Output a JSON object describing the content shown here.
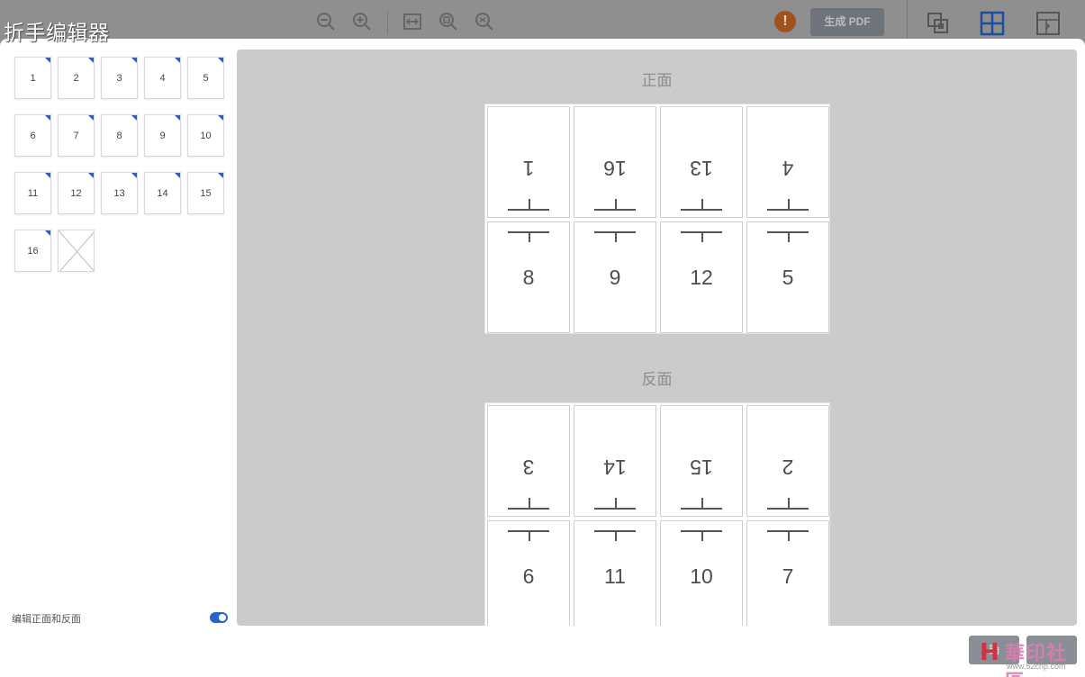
{
  "window": {
    "title": "折手编辑器"
  },
  "toolbar": {
    "generate_pdf_label": "生成 PDF",
    "warning_glyph": "!",
    "icons": [
      "zoom-out-icon",
      "zoom-in-icon",
      "fit-width-icon",
      "fit-page-icon",
      "zoom-fit-icon",
      "warning-icon",
      "copy-pages-icon",
      "grid-layout-icon",
      "split-layout-icon"
    ],
    "colors": {
      "accent": "#2566c8",
      "warning": "#a0521d"
    }
  },
  "thumbnails": {
    "pages": [
      "1",
      "2",
      "3",
      "4",
      "5",
      "6",
      "7",
      "8",
      "9",
      "10",
      "11",
      "12",
      "13",
      "14",
      "15",
      "16"
    ],
    "blank_slots": 1
  },
  "options": {
    "edit_front_back_label": "编辑正面和反面",
    "edit_front_back_on": true
  },
  "front": {
    "title": "正面",
    "top_row": [
      "1",
      "16",
      "13",
      "4"
    ],
    "bottom_row": [
      "8",
      "9",
      "12",
      "5"
    ]
  },
  "back": {
    "title": "反面",
    "top_row": [
      "3",
      "14",
      "15",
      "2"
    ],
    "bottom_row": [
      "6",
      "11",
      "10",
      "7"
    ]
  },
  "footer": {
    "confirm_label": "确",
    "cancel_label": ""
  },
  "watermark": {
    "text": "華印社區",
    "url": "www.52cnp.com"
  }
}
